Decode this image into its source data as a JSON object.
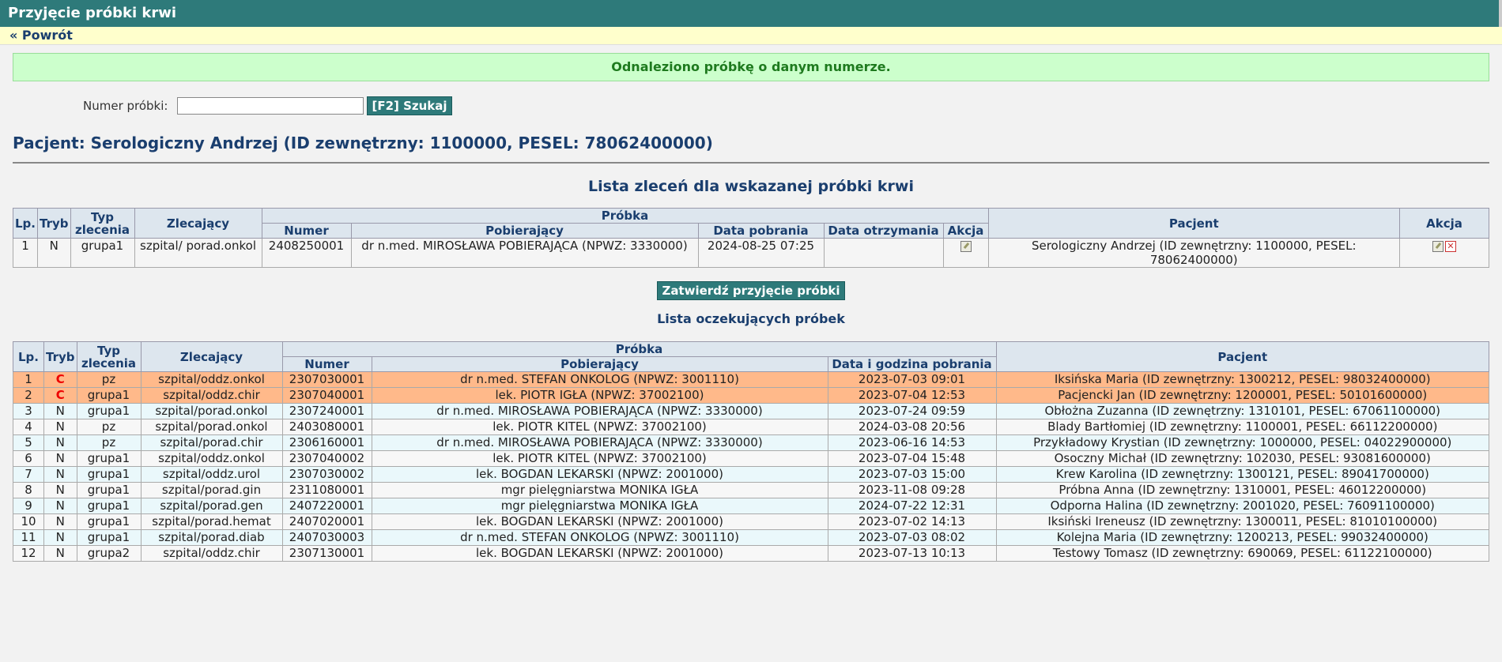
{
  "header": {
    "title": "Przyjęcie próbki krwi"
  },
  "nav": {
    "back": "« Powrót"
  },
  "message": {
    "success": "Odnaleziono próbkę o danym numerze."
  },
  "search": {
    "label": "Numer próbki:",
    "value": "",
    "button": "[F2] Szukaj"
  },
  "patient": {
    "heading": "Pacjent: Serologiczny Andrzej (ID zewnętrzny: 1100000, PESEL: 78062400000)"
  },
  "orders": {
    "title": "Lista zleceń dla wskazanej próbki krwi",
    "headers": {
      "lp": "Lp.",
      "tryb": "Tryb",
      "typ": "Typ zlecenia",
      "zlecajacy": "Zlecający",
      "probka": "Próbka",
      "numer": "Numer",
      "pobierajacy": "Pobierający",
      "data_pobrania": "Data pobrania",
      "data_otrzymania": "Data otrzymania",
      "akcja_probki": "Akcja",
      "pacjent": "Pacjent",
      "akcja": "Akcja"
    },
    "rows": [
      {
        "lp": "1",
        "tryb": "N",
        "typ": "grupa1",
        "zlecajacy": "szpital/ porad.onkol",
        "numer": "2408250001",
        "pobierajacy": "dr n.med. MIROSŁAWA POBIERAJĄCA (NPWZ: 3330000)",
        "data_pobrania": "2024-08-25 07:25",
        "data_otrzymania": "",
        "pacjent": "Serologiczny Andrzej (ID zewnętrzny: 1100000, PESEL: 78062400000)"
      }
    ]
  },
  "confirm": {
    "button": "Zatwierdź przyjęcie próbki"
  },
  "waiting": {
    "title": "Lista oczekujących próbek",
    "headers": {
      "lp": "Lp.",
      "tryb": "Tryb",
      "typ": "Typ zlecenia",
      "zlecajacy": "Zlecający",
      "probka": "Próbka",
      "numer": "Numer",
      "pobierajacy": "Pobierający",
      "data": "Data i godzina pobrania",
      "pacjent": "Pacjent"
    },
    "rows": [
      {
        "lp": "1",
        "tryb": "C",
        "typ": "pz",
        "zlecajacy": "szpital/oddz.onkol",
        "numer": "2307030001",
        "pobierajacy": "dr n.med. STEFAN ONKOLOG (NPWZ: 3001110)",
        "data": "2023-07-03 09:01",
        "pacjent": "Iksińska Maria (ID zewnętrzny: 1300212, PESEL: 98032400000)"
      },
      {
        "lp": "2",
        "tryb": "C",
        "typ": "grupa1",
        "zlecajacy": "szpital/oddz.chir",
        "numer": "2307040001",
        "pobierajacy": "lek. PIOTR IGŁA (NPWZ: 37002100)",
        "data": "2023-07-04 12:53",
        "pacjent": "Pacjencki Jan (ID zewnętrzny: 1200001, PESEL: 50101600000)"
      },
      {
        "lp": "3",
        "tryb": "N",
        "typ": "grupa1",
        "zlecajacy": "szpital/porad.onkol",
        "numer": "2307240001",
        "pobierajacy": "dr n.med. MIROSŁAWA POBIERAJĄCA (NPWZ: 3330000)",
        "data": "2023-07-24 09:59",
        "pacjent": "Obłożna Zuzanna (ID zewnętrzny: 1310101, PESEL: 67061100000)"
      },
      {
        "lp": "4",
        "tryb": "N",
        "typ": "pz",
        "zlecajacy": "szpital/porad.onkol",
        "numer": "2403080001",
        "pobierajacy": "lek. PIOTR KITEL (NPWZ: 37002100)",
        "data": "2024-03-08 20:56",
        "pacjent": "Blady Bartłomiej (ID zewnętrzny: 1100001, PESEL: 66112200000)"
      },
      {
        "lp": "5",
        "tryb": "N",
        "typ": "pz",
        "zlecajacy": "szpital/porad.chir",
        "numer": "2306160001",
        "pobierajacy": "dr n.med. MIROSŁAWA POBIERAJĄCA (NPWZ: 3330000)",
        "data": "2023-06-16 14:53",
        "pacjent": "Przykładowy Krystian (ID zewnętrzny: 1000000, PESEL: 04022900000)"
      },
      {
        "lp": "6",
        "tryb": "N",
        "typ": "grupa1",
        "zlecajacy": "szpital/oddz.onkol",
        "numer": "2307040002",
        "pobierajacy": "lek. PIOTR KITEL (NPWZ: 37002100)",
        "data": "2023-07-04 15:48",
        "pacjent": "Osoczny Michał (ID zewnętrzny: 102030, PESEL: 93081600000)"
      },
      {
        "lp": "7",
        "tryb": "N",
        "typ": "grupa1",
        "zlecajacy": "szpital/oddz.urol",
        "numer": "2307030002",
        "pobierajacy": "lek. BOGDAN LEKARSKI (NPWZ: 2001000)",
        "data": "2023-07-03 15:00",
        "pacjent": "Krew Karolina (ID zewnętrzny: 1300121, PESEL: 89041700000)"
      },
      {
        "lp": "8",
        "tryb": "N",
        "typ": "grupa1",
        "zlecajacy": "szpital/porad.gin",
        "numer": "2311080001",
        "pobierajacy": "mgr pielęgniarstwa MONIKA IGŁA",
        "data": "2023-11-08 09:28",
        "pacjent": "Próbna Anna (ID zewnętrzny: 1310001, PESEL: 46012200000)"
      },
      {
        "lp": "9",
        "tryb": "N",
        "typ": "grupa1",
        "zlecajacy": "szpital/porad.gen",
        "numer": "2407220001",
        "pobierajacy": "mgr pielęgniarstwa MONIKA IGŁA",
        "data": "2024-07-22 12:31",
        "pacjent": "Odporna Halina (ID zewnętrzny: 2001020, PESEL: 76091100000)"
      },
      {
        "lp": "10",
        "tryb": "N",
        "typ": "grupa1",
        "zlecajacy": "szpital/porad.hemat",
        "numer": "2407020001",
        "pobierajacy": "lek. BOGDAN LEKARSKI (NPWZ: 2001000)",
        "data": "2023-07-02 14:13",
        "pacjent": "Iksiński Ireneusz (ID zewnętrzny: 1300011, PESEL: 81010100000)"
      },
      {
        "lp": "11",
        "tryb": "N",
        "typ": "grupa1",
        "zlecajacy": "szpital/porad.diab",
        "numer": "2407030003",
        "pobierajacy": "dr n.med. STEFAN ONKOLOG (NPWZ: 3001110)",
        "data": "2023-07-03 08:02",
        "pacjent": "Kolejna Maria (ID zewnętrzny: 1200213, PESEL: 99032400000)"
      },
      {
        "lp": "12",
        "tryb": "N",
        "typ": "grupa2",
        "zlecajacy": "szpital/oddz.chir",
        "numer": "2307130001",
        "pobierajacy": "lek. BOGDAN LEKARSKI (NPWZ: 2001000)",
        "data": "2023-07-13 10:13",
        "pacjent": "Testowy Tomasz (ID zewnętrzny: 690069, PESEL: 61122100000)"
      }
    ]
  },
  "colors": {
    "header": "#2e7a7a",
    "success_bg": "#ccffcc",
    "urgent_row": "#ffb98a",
    "urgent_text": "#e00000"
  },
  "icons": {
    "edit": "edit-icon",
    "delete": "delete-icon"
  }
}
